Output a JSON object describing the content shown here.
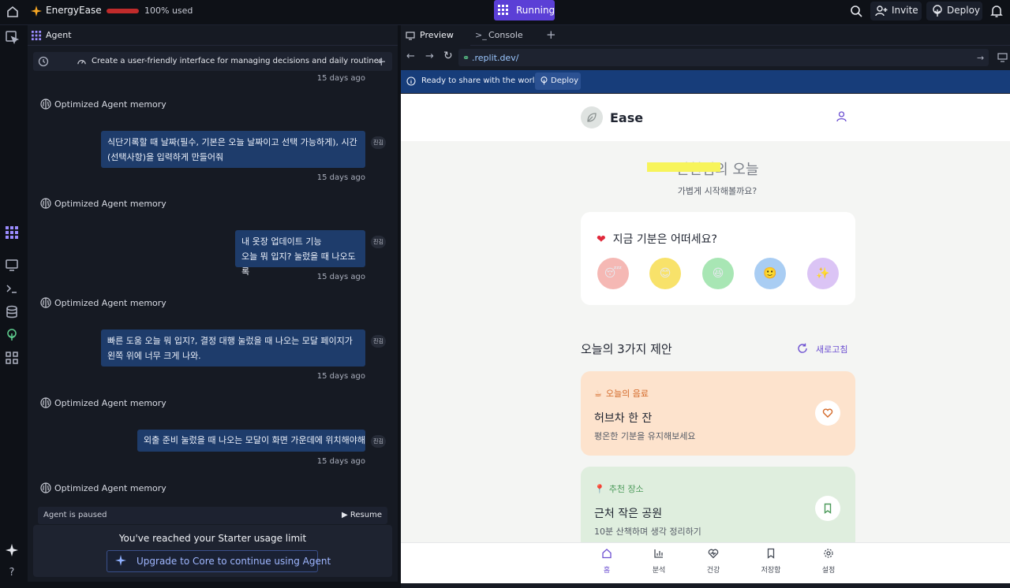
{
  "topbar": {
    "app_name": "EnergyEase",
    "usage_text": "100% used",
    "usage_percent": 100,
    "status": "Running",
    "invite": "Invite",
    "deploy": "Deploy"
  },
  "agent": {
    "tab_label": "Agent",
    "task_title": "Create a user-friendly interface for managing decisions and daily routines",
    "messages": [
      {
        "ts": "15 days ago"
      },
      {
        "memory": "Optimized Agent memory"
      },
      {
        "text": "식단기록할 때 날짜(필수, 기본은 오늘 날짜이고 선택 가능하게), 시간 (선택사항)을 입력하게 만들어줘",
        "tag": "진김",
        "ts": "15 days ago"
      },
      {
        "memory": "Optimized Agent memory"
      },
      {
        "text": "내 옷장 업데이트 기능\n오늘 뭐 입지? 눌렀을 때 나오도록",
        "tag": "진김",
        "ts": "15 days ago"
      },
      {
        "memory": "Optimized Agent memory"
      },
      {
        "text": "빠른 도움 오늘 뭐 입지?, 결정 대행 눌렀을 때 나오는 모달 페이지가 왼쪽 위에 너무 크게 나와.",
        "tag": "진김",
        "ts": "15 days ago"
      },
      {
        "memory": "Optimized Agent memory"
      },
      {
        "text": "외출 준비 눌렀을 때 나오는 모달이 화면 가운데에 위치해야해",
        "tag": "진김",
        "ts": "15 days ago"
      },
      {
        "memory": "Optimized Agent memory"
      }
    ],
    "paused_text": "Agent is paused",
    "resume": "Resume",
    "limit_text": "You've reached your Starter usage limit",
    "upgrade": "Upgrade to Core to continue using Agent"
  },
  "preview": {
    "tab_preview": "Preview",
    "tab_console": "Console",
    "url": ".replit.dev/",
    "banner_text": "Ready to share with the world?",
    "banner_deploy": "Deploy"
  },
  "app": {
    "name": "Ease",
    "greeting": "진현님의 오늘",
    "subtitle": "가볍게 시작해볼까요?",
    "mood_question": "지금 기분은 어떠세요?",
    "moods": [
      {
        "emoji": "😴",
        "color": "#f5b8b4"
      },
      {
        "emoji": "😊",
        "color": "#f8e26a"
      },
      {
        "emoji": "😆",
        "color": "#a8e6b4"
      },
      {
        "emoji": "🙂",
        "color": "#a9cdf3"
      },
      {
        "emoji": "✨",
        "color": "#dbc4f5"
      }
    ],
    "section_title": "오늘의 3가지 제안",
    "refresh": "새로고침",
    "suggestions": [
      {
        "icon": "☕",
        "category": "오늘의 음료",
        "title": "허브차 한 잔",
        "desc": "평온한 기분을 유지해보세요",
        "cat_color": "#d46a2a",
        "bg": "#fde3cd"
      },
      {
        "icon": "📍",
        "category": "추천 장소",
        "title": "근처 작은 공원",
        "desc": "10분 산책하며 생각 정리하기",
        "cat_color": "#4c9a5a",
        "bg": "#dfeede"
      }
    ],
    "nav": [
      "홈",
      "분석",
      "건강",
      "저장함",
      "설정"
    ],
    "nav_active": 0
  }
}
